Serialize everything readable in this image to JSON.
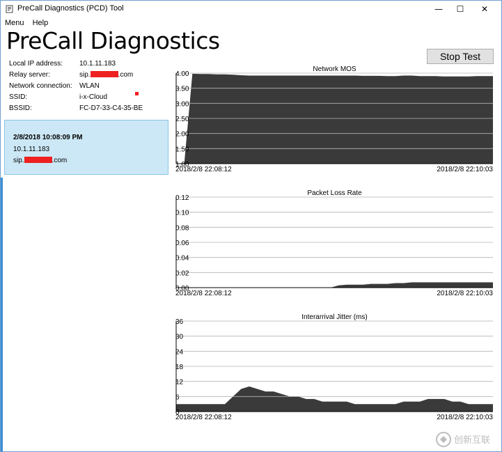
{
  "window": {
    "title": "PreCall Diagnostics (PCD) Tool",
    "controls": {
      "minimize": "—",
      "maximize": "☐",
      "close": "✕"
    }
  },
  "menu": {
    "items": [
      "Menu",
      "Help"
    ]
  },
  "app_title": "PreCall Diagnostics",
  "info": [
    {
      "label": "Local IP address:",
      "value": "10.1.11.183"
    },
    {
      "label": "Relay server:",
      "value_prefix": "sip.",
      "value_suffix": ".com",
      "redacted": true
    },
    {
      "label": "Network connection:",
      "value": "WLAN"
    },
    {
      "label": "SSID:",
      "value": "i-x-Cloud"
    },
    {
      "label": "BSSID:",
      "value": "FC-D7-33-C4-35-BE"
    }
  ],
  "session": {
    "timestamp": "2/8/2018 10:08:09 PM",
    "ip": "10.1.11.183",
    "server_prefix": "sip.",
    "server_suffix": ".com"
  },
  "stop_button": "Stop Test",
  "watermark": {
    "brand": "创新互联"
  },
  "colors": {
    "fill": "#3a3a3a",
    "session_bg": "#cce8f6",
    "accent": "#3b8ed6",
    "redaction": "#ee2020"
  },
  "chart_data": [
    {
      "type": "area",
      "title": "Network MOS",
      "x_start": "2018/2/8 22:08:12",
      "x_end": "2018/2/8 22:10:03",
      "ylim": [
        1.0,
        4.0
      ],
      "yticks": [
        "4.00",
        "3.50",
        "3.00",
        "2.50",
        "2.00",
        "1.50",
        "1.00"
      ],
      "grid": true,
      "values": [
        1.0,
        1.02,
        3.98,
        3.97,
        3.97,
        3.96,
        3.96,
        3.95,
        3.93,
        3.92,
        3.92,
        3.92,
        3.92,
        3.92,
        3.92,
        3.92,
        3.92,
        3.92,
        3.92,
        3.92,
        3.92,
        3.92,
        3.92,
        3.91,
        3.91,
        3.91,
        3.9,
        3.9,
        3.92,
        3.92,
        3.9,
        3.9,
        3.9,
        3.89,
        3.89,
        3.89,
        3.89,
        3.9,
        3.9,
        3.9
      ]
    },
    {
      "type": "area",
      "title": "Packet Loss Rate",
      "x_start": "2018/2/8 22:08:12",
      "x_end": "2018/2/8 22:10:03",
      "ylim": [
        0.0,
        0.12
      ],
      "yticks": [
        "0.12",
        "0.10",
        "0.08",
        "0.06",
        "0.04",
        "0.02",
        "0.00"
      ],
      "grid": true,
      "values": [
        0,
        0,
        0,
        0,
        0,
        0,
        0,
        0,
        0,
        0,
        0,
        0,
        0,
        0,
        0,
        0,
        0,
        0,
        0,
        0,
        0.003,
        0.004,
        0.004,
        0.004,
        0.005,
        0.005,
        0.005,
        0.006,
        0.006,
        0.007,
        0.007,
        0.007,
        0.007,
        0.007,
        0.007,
        0.007,
        0.007,
        0.007,
        0.007,
        0.007
      ]
    },
    {
      "type": "area",
      "title": "Interarrival Jitter (ms)",
      "x_start": "2018/2/8 22:08:12",
      "x_end": "2018/2/8 22:10:03",
      "ylim": [
        0,
        36
      ],
      "yticks": [
        "36",
        "30",
        "24",
        "18",
        "12",
        "6",
        "0"
      ],
      "grid": true,
      "values": [
        3,
        3,
        3,
        3,
        3,
        3,
        3,
        6,
        9,
        10,
        9,
        8,
        8,
        7,
        6,
        6,
        5,
        5,
        4,
        4,
        4,
        4,
        3,
        3,
        3,
        3,
        3,
        3,
        4,
        4,
        4,
        5,
        5,
        5,
        4,
        4,
        3,
        3,
        3,
        3
      ]
    }
  ]
}
